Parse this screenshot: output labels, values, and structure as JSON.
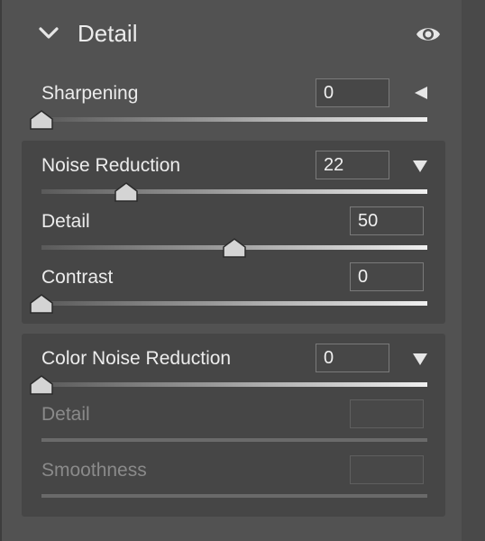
{
  "header": {
    "title": "Detail",
    "collapse_icon": "chevron-down-icon",
    "visibility_icon": "eye-icon"
  },
  "sharpening": {
    "label": "Sharpening",
    "value": "0",
    "toggle_icon": "triangle-left-icon",
    "level": 0
  },
  "noise_reduction": {
    "label": "Noise Reduction",
    "value": "22",
    "toggle_icon": "triangle-down-icon",
    "level": 0.22,
    "detail": {
      "label": "Detail",
      "value": "50",
      "level": 0.5
    },
    "contrast": {
      "label": "Contrast",
      "value": "0",
      "level": 0
    }
  },
  "color_noise_reduction": {
    "label": "Color Noise Reduction",
    "value": "0",
    "toggle_icon": "triangle-down-icon",
    "level": 0,
    "detail": {
      "label": "Detail",
      "value": ""
    },
    "smoothness": {
      "label": "Smoothness",
      "value": ""
    }
  },
  "colors": {
    "panel": "#525252",
    "group": "#464646",
    "text": "#ececec",
    "disabled_text": "#8a8a8a"
  }
}
